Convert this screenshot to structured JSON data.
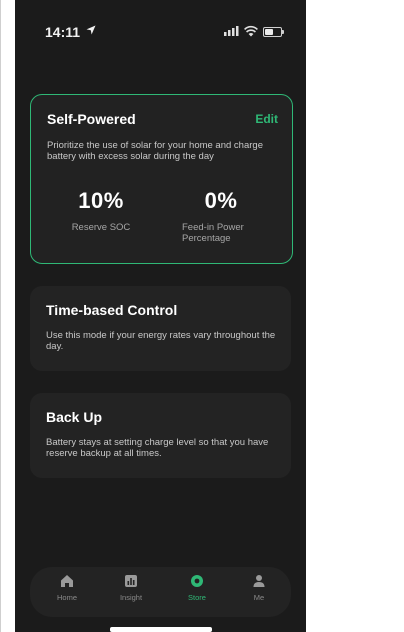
{
  "status_bar": {
    "time": "14:11"
  },
  "modes": [
    {
      "title": "Self-Powered",
      "edit_label": "Edit",
      "description": "Prioritize the use of solar for your home and charge battery with excess solar during the day",
      "stats": [
        {
          "value": "10%",
          "label": "Reserve SOC"
        },
        {
          "value": "0%",
          "label": "Feed-in Power Percentage"
        }
      ]
    },
    {
      "title": "Time-based Control",
      "description": "Use this mode if your energy rates vary throughout the day."
    },
    {
      "title": "Back Up",
      "description": "Battery stays at setting charge level so that you have reserve backup at all times."
    }
  ],
  "tabbar": {
    "items": [
      {
        "label": "Home",
        "icon": "home-icon"
      },
      {
        "label": "Insight",
        "icon": "chart-icon"
      },
      {
        "label": "Store",
        "icon": "store-icon",
        "active": true
      },
      {
        "label": "Me",
        "icon": "user-icon"
      }
    ]
  },
  "colors": {
    "accent": "#2fb876",
    "background": "#1b1b1b",
    "card": "#232323"
  }
}
